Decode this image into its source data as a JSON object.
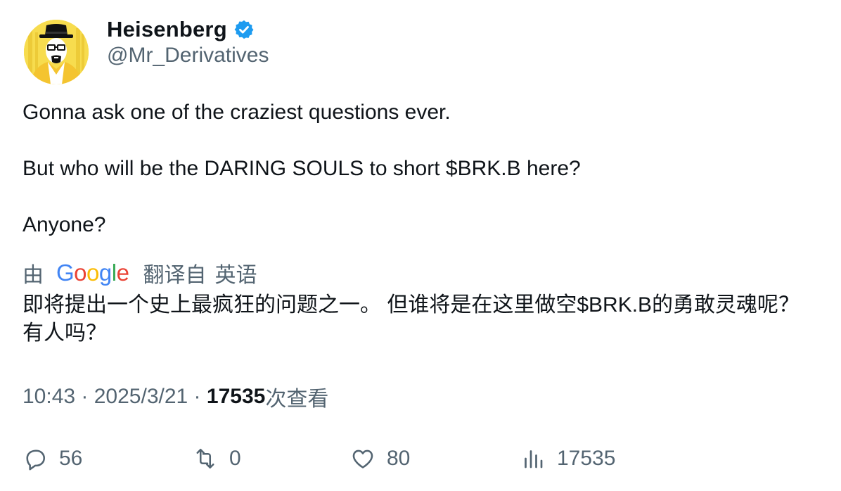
{
  "author": {
    "display_name": "Heisenberg",
    "handle": "@Mr_Derivatives",
    "verified": true,
    "avatar_icon": "heisenberg-portrait",
    "badge_color": "#1d9bf0"
  },
  "tweet": {
    "lines": [
      "Gonna ask one of the craziest questions ever.",
      "But who will be the DARING SOULS to short $BRK.B here?",
      "Anyone?"
    ]
  },
  "translation": {
    "by_label": "由",
    "provider_letters": [
      "G",
      "o",
      "o",
      "g",
      "l",
      "e"
    ],
    "provider_colors": [
      "#4285f4",
      "#ea4335",
      "#fbbc05",
      "#4285f4",
      "#34a853",
      "#ea4335"
    ],
    "from_label": "翻译自",
    "language": "英语",
    "text": "即将提出一个史上最疯狂的问题之一。 但谁将是在这里做空$BRK.B的勇敢灵魂呢？ 有人吗？"
  },
  "meta": {
    "time": "10:43",
    "separator": " · ",
    "date": "2025/3/21",
    "view_count": "17535",
    "views_label": "次查看"
  },
  "actions": {
    "reply_count": "56",
    "retweet_count": "0",
    "like_count": "80",
    "view_count": "17535",
    "icon_color": "#536471"
  }
}
